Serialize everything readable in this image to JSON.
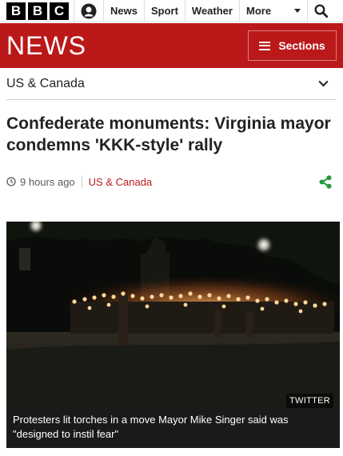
{
  "topnav": {
    "logo_letters": [
      "B",
      "B",
      "C"
    ],
    "links": [
      "News",
      "Sport",
      "Weather"
    ],
    "more_label": "More"
  },
  "banner": {
    "title": "NEWS",
    "sections_label": "Sections",
    "background_color": "#bb1919"
  },
  "section_bar": {
    "label": "US & Canada"
  },
  "article": {
    "headline": "Confederate monuments: Virginia mayor condemns 'KKK-style' rally",
    "time": "9 hours ago",
    "section": "US & Canada",
    "image_credit": "TWITTER",
    "caption": "Protesters lit torches in a move Mayor Mike Singer said was \"designed to instil fear\""
  },
  "icons": {
    "account": "account-icon",
    "search": "search-icon",
    "menu": "menu-icon",
    "chevron": "chevron-down-icon",
    "clock": "clock-icon",
    "share": "share-icon"
  },
  "colors": {
    "accent": "#bb1919",
    "share": "#1f9a3a"
  }
}
